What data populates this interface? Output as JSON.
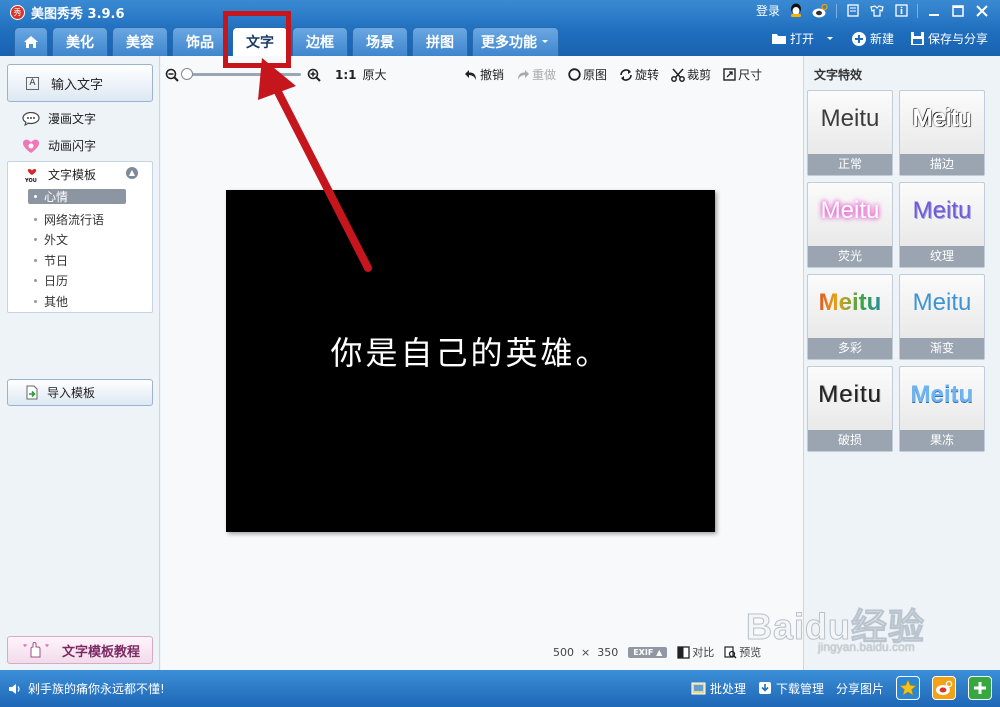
{
  "app": {
    "title": "美图秀秀 3.9.6",
    "logo_char": "秀"
  },
  "topbar": {
    "login": "登录"
  },
  "tabs": [
    {
      "label": "美化"
    },
    {
      "label": "美容"
    },
    {
      "label": "饰品"
    },
    {
      "label": "文字",
      "active": true
    },
    {
      "label": "边框"
    },
    {
      "label": "场景"
    },
    {
      "label": "拼图"
    },
    {
      "label": "更多功能"
    }
  ],
  "toolbar": {
    "open": "打开",
    "new": "新建",
    "save_share": "保存与分享"
  },
  "left": {
    "input_text": "输入文字",
    "input_icon_char": "A",
    "comic_text": "漫画文字",
    "animated_text": "动画闪字",
    "template_title": "文字模板",
    "template_items": [
      "心情",
      "网络流行语",
      "外文",
      "节日",
      "日历",
      "其他"
    ],
    "import_template": "导入模板",
    "tutorial": "文字模板教程"
  },
  "canvas": {
    "zoom_ratio": "1:1",
    "zoom_original": "原大",
    "undo": "撤销",
    "redo": "重做",
    "original": "原图",
    "rotate": "旋转",
    "crop": "裁剪",
    "size": "尺寸",
    "photo_text": "你是自己的英雄。",
    "image_width": "500",
    "image_height": "350",
    "exif": "EXIF",
    "compare": "对比",
    "preview": "预览"
  },
  "right": {
    "title": "文字特效",
    "sample": "Meitu",
    "effects": [
      {
        "label": "正常"
      },
      {
        "label": "描边"
      },
      {
        "label": "荧光"
      },
      {
        "label": "纹理"
      },
      {
        "label": "多彩"
      },
      {
        "label": "渐变"
      },
      {
        "label": "破损"
      },
      {
        "label": "果冻"
      }
    ]
  },
  "bottom": {
    "status_text": "剁手族的痛你永远都不懂!",
    "batch": "批处理",
    "download_mgr": "下载管理",
    "share_pic": "分享图片"
  },
  "watermark": {
    "main": "Baidu经验",
    "sub": "jingyan.baidu.com"
  },
  "colors": {
    "accent": "#1f6fbe",
    "highlight": "#c4161c"
  }
}
